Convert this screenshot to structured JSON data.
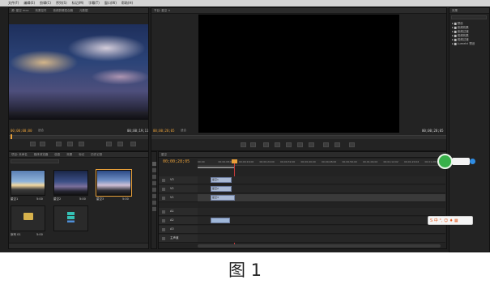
{
  "menu": [
    "文件(F)",
    "编辑(E)",
    "剪辑(C)",
    "序列(S)",
    "标记(M)",
    "字幕(T)",
    "窗口(W)",
    "帮助(H)"
  ],
  "source_monitor": {
    "tabs": [
      "源: 星空 mov",
      "效果控件",
      "音频剪辑混合器",
      "元数据"
    ],
    "timecode_left": "00;00;00;00",
    "fit_label": "适合",
    "timecode_right": "00;00;19;11"
  },
  "program_monitor": {
    "tabs": [
      "节目: 星空 ×"
    ],
    "timecode_left": "00;00;28;05",
    "fit_label": "适合",
    "timecode_right": "00;00;28;05"
  },
  "effects_panel": {
    "tabs": [
      "效果"
    ],
    "items": [
      "预设",
      "音频效果",
      "音频过渡",
      "视频效果",
      "视频过渡",
      "Lumetri 预设"
    ]
  },
  "project_panel": {
    "tabs": [
      "项目: 未命名",
      "媒体浏览器",
      "信息",
      "效果",
      "标记",
      "历史记录"
    ],
    "thumbs": [
      {
        "label": "星空1",
        "duration": "5:00"
      },
      {
        "label": "星空2",
        "duration": "5:00"
      },
      {
        "label": "星空3",
        "duration": "5:00"
      },
      {
        "label": "序列 01",
        "duration": "5:00"
      },
      {
        "label": "",
        "duration": ""
      }
    ]
  },
  "timeline": {
    "tab": "星空",
    "timecode": "00;00;28;05",
    "ticks": [
      "00;00",
      "00;00;08;00",
      "00;00;16;00",
      "00;00;24;00",
      "00;00;32;00",
      "00;00;40;00",
      "00;00;48;00",
      "00;00;56;00",
      "00;01;04;02",
      "00;01;12;02",
      "00;01;20;02",
      "00;01;28;02"
    ],
    "tracks": [
      "V3",
      "V2",
      "V1",
      "A1",
      "A2",
      "A3",
      "主声道"
    ],
    "clips": [
      {
        "label": "星空1",
        "track": 0
      },
      {
        "label": "星空2",
        "track": 1
      },
      {
        "label": "星空3",
        "track": 2
      }
    ],
    "audio_clip": {
      "label": "",
      "track": 4
    }
  },
  "ime_bar": {
    "label": "S 中 °, ☺ ♦ ▦"
  },
  "caption": "图 1",
  "colors": {
    "timecode": "#e8a03a",
    "panel_bg": "#232323",
    "playhead": "#c23a3a",
    "clip": "#a9b9d4"
  }
}
